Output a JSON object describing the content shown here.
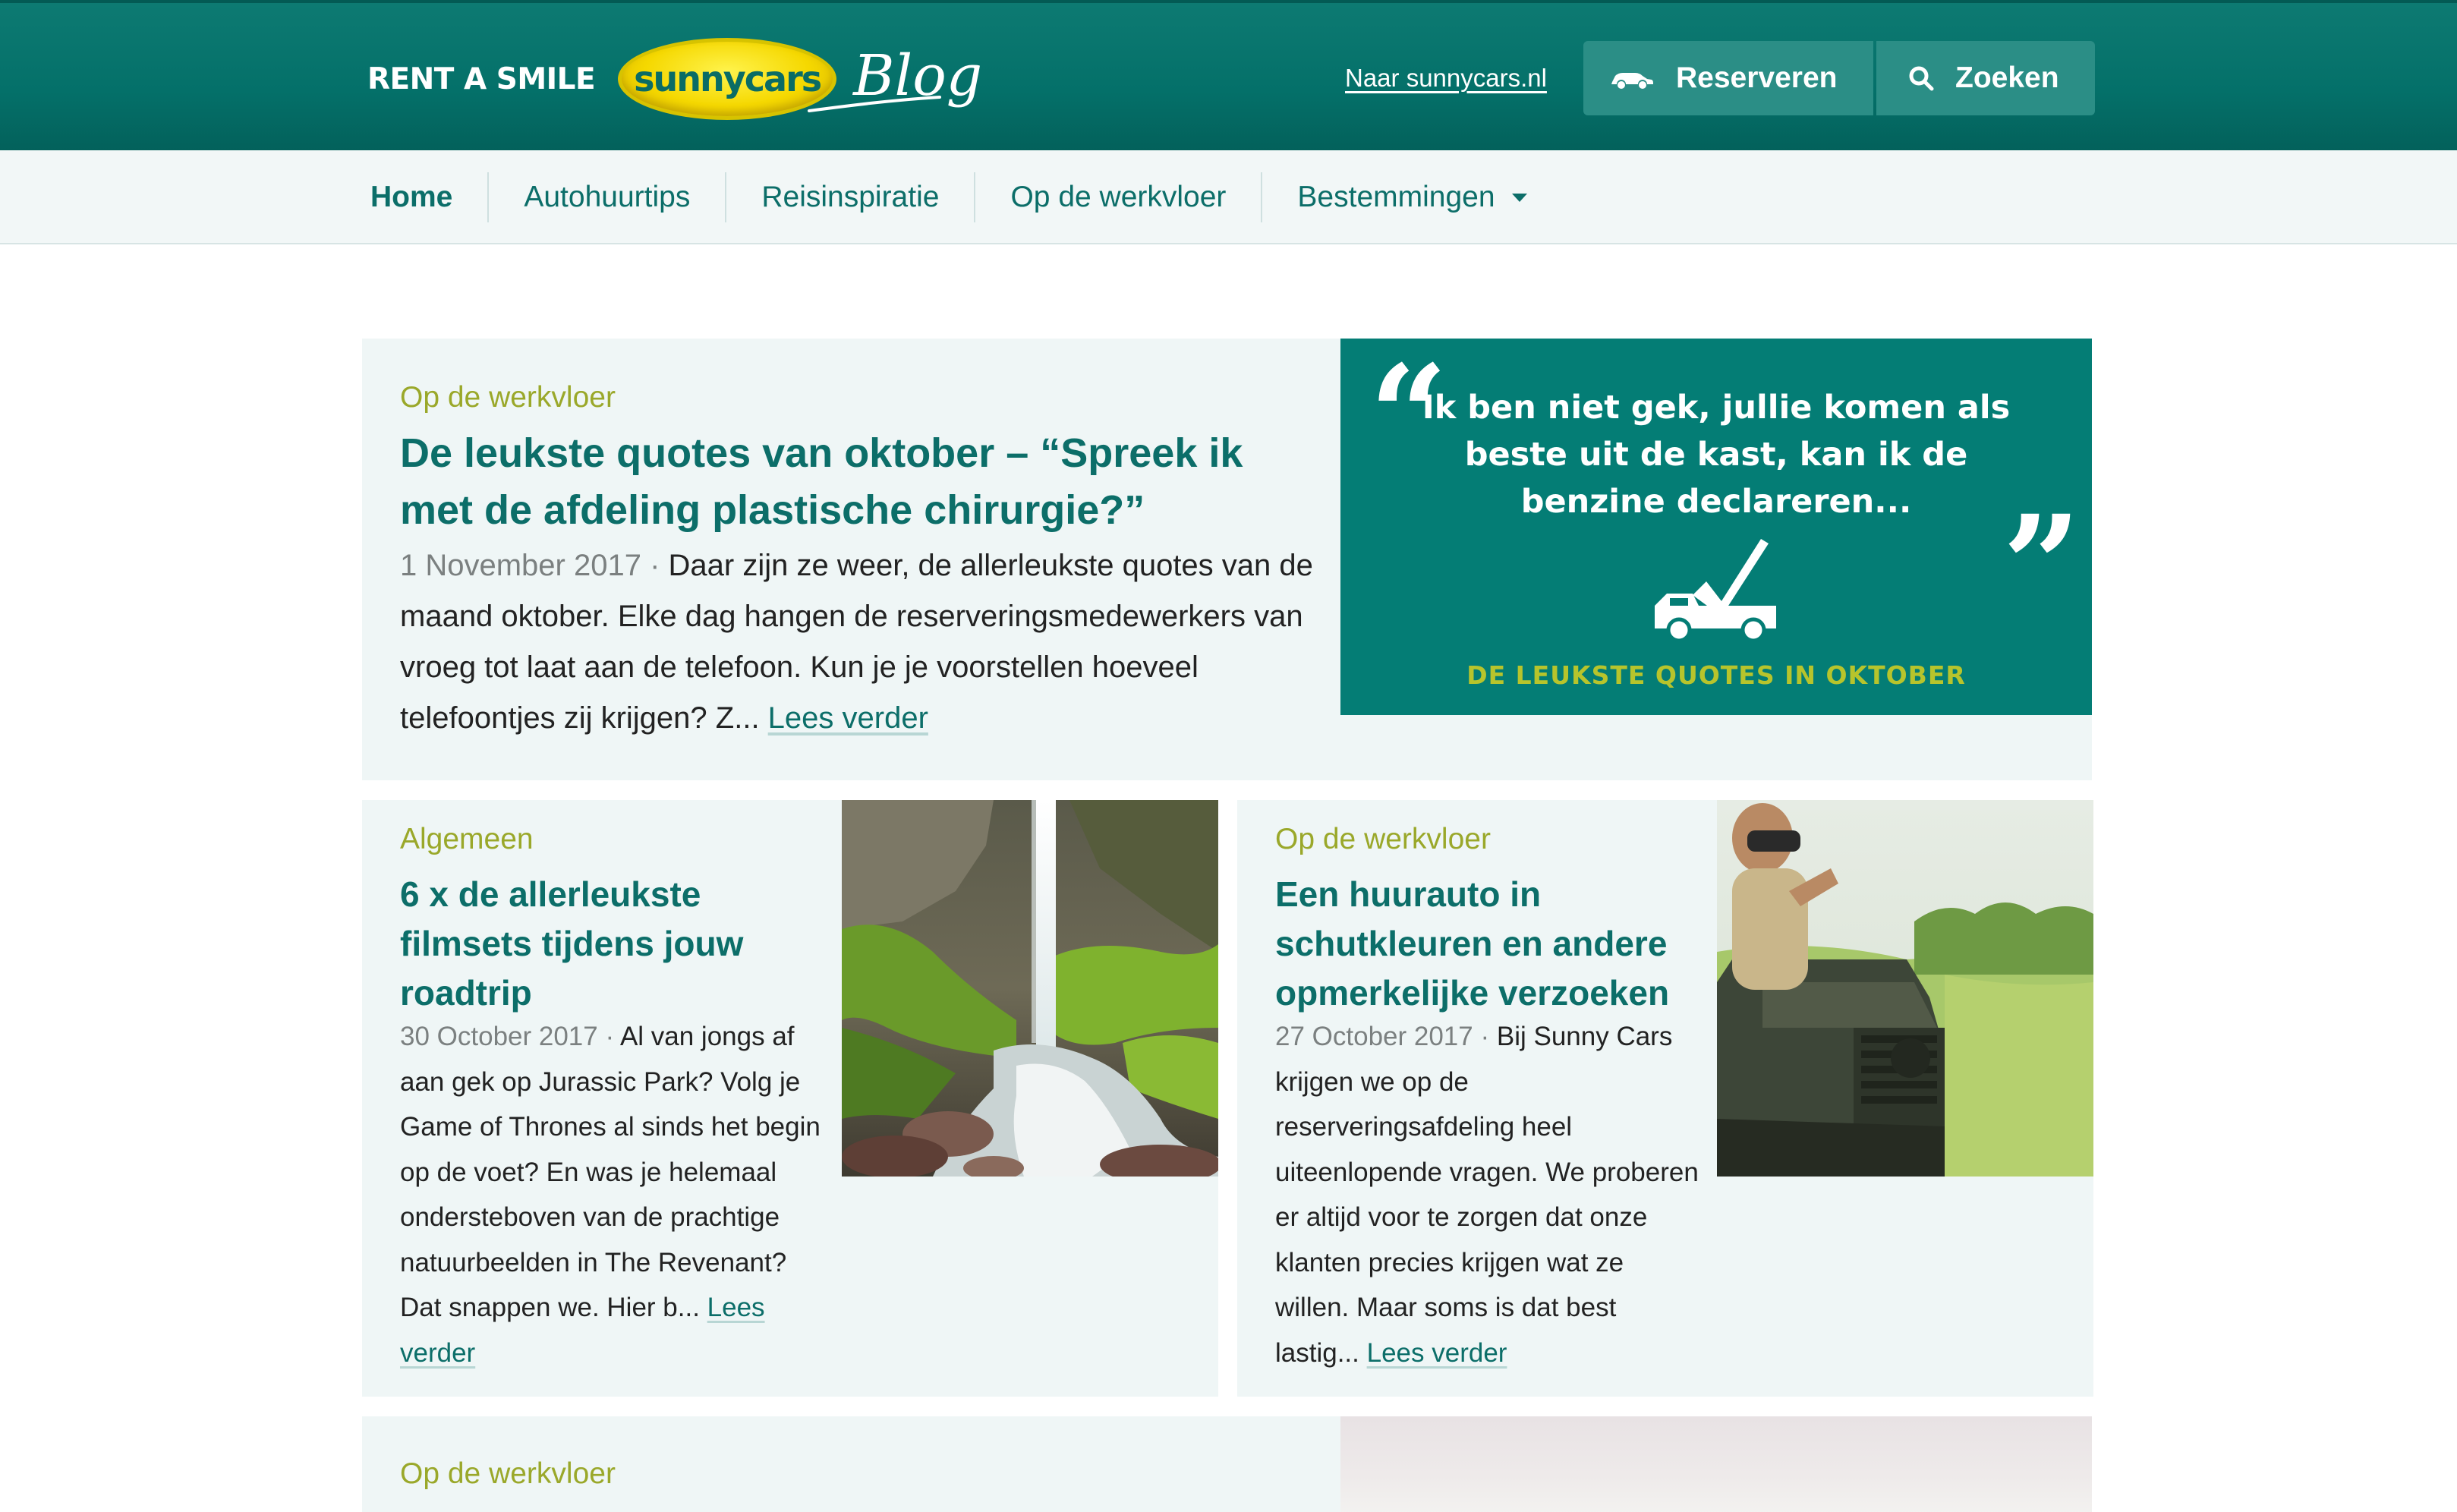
{
  "header": {
    "tagline": "RENT A SMILE",
    "logo_text": "sunnycars",
    "blog_label": "Blog",
    "external_link": "Naar sunnycars.nl",
    "reserve_label": "Reserveren",
    "search_label": "Zoeken"
  },
  "nav": {
    "items": [
      {
        "label": "Home"
      },
      {
        "label": "Autohuurtips"
      },
      {
        "label": "Reisinspiratie"
      },
      {
        "label": "Op de werkvloer"
      },
      {
        "label": "Bestemmingen"
      }
    ]
  },
  "featured": {
    "category": "Op de werkvloer",
    "title": "De leukste quotes van oktober – “Spreek ik met de afdeling plastische chirurgie?”",
    "date": "1 November 2017",
    "separator": " · ",
    "excerpt": "Daar zijn ze weer, de allerleukste quotes van de maand oktober. Elke dag hangen de reserveringsmedewerkers van vroeg tot laat aan de telefoon. Kun je je voorstellen hoeveel telefoontjes zij krijgen? Z... ",
    "read_more": "Lees verder",
    "image": {
      "quote_line": "Ik ben niet gek, jullie komen als beste uit de kast, kan ik de benzine declareren...",
      "caption": "DE LEUKSTE QUOTES IN OKTOBER"
    }
  },
  "posts": [
    {
      "category": "Algemeen",
      "title": "6 x de allerleukste filmsets tijdens jouw roadtrip",
      "date": "30 October 2017",
      "separator": " · ",
      "excerpt": "Al van jongs af aan gek op Jurassic Park? Volg je Game of Thrones al sinds het begin op de voet? En was je helemaal ondersteboven van de prachtige natuurbeelden in The Revenant? Dat snappen we. Hier b... ",
      "read_more": "Lees verder"
    },
    {
      "category": "Op de werkvloer",
      "title": "Een huurauto in schutkleuren en andere opmerkelijke verzoeken",
      "date": "27 October 2017",
      "separator": " · ",
      "excerpt": "Bij Sunny Cars krijgen we op de reserveringsafdeling heel uiteenlopende vragen. We proberen er altijd voor te zorgen dat onze klanten precies krijgen wat ze willen. Maar soms is dat best lastig... ",
      "read_more": "Lees verder"
    }
  ],
  "next_post": {
    "category": "Op de werkvloer"
  },
  "colors": {
    "brand_teal": "#047069",
    "link_teal": "#0c6e69",
    "category_green": "#9aa82a",
    "card_bg": "#eff6f6",
    "logo_yellow": "#f5d800"
  },
  "icons": [
    "car-icon",
    "search-icon",
    "chevron-down-icon",
    "quote-open-icon",
    "quote-close-icon",
    "car-check-icon"
  ]
}
